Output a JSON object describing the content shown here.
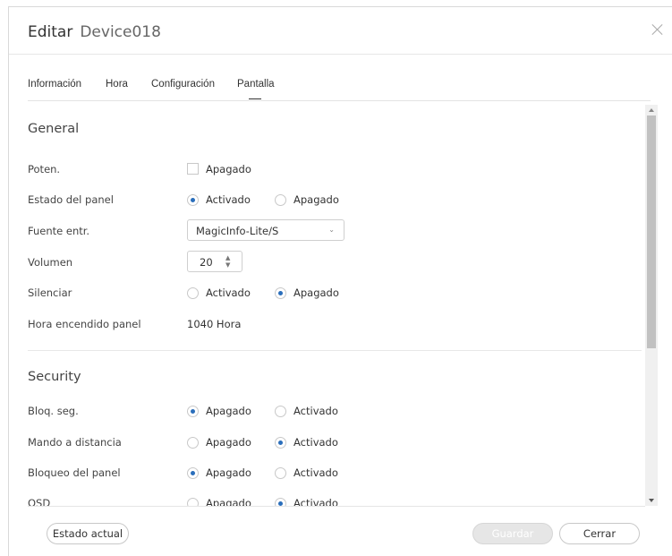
{
  "dialog": {
    "title": "Editar",
    "device_name": "Device018"
  },
  "tabs": [
    {
      "label": "Información",
      "active": false
    },
    {
      "label": "Hora",
      "active": false
    },
    {
      "label": "Configuración",
      "active": false
    },
    {
      "label": "Pantalla",
      "active": true
    }
  ],
  "general": {
    "title": "General",
    "power": {
      "label": "Poten.",
      "checkbox_label": "Apagado",
      "checked": false
    },
    "panel_state": {
      "label": "Estado del panel",
      "options": [
        "Activado",
        "Apagado"
      ],
      "selected": "Activado"
    },
    "input_source": {
      "label": "Fuente entr.",
      "value": "MagicInfo-Lite/S"
    },
    "volume": {
      "label": "Volumen",
      "value": "20"
    },
    "mute": {
      "label": "Silenciar",
      "options": [
        "Activado",
        "Apagado"
      ],
      "selected": "Apagado"
    },
    "panel_on_time": {
      "label": "Hora encendido panel",
      "value": "1040 Hora"
    }
  },
  "security": {
    "title": "Security",
    "safety_lock": {
      "label": "Bloq. seg.",
      "options": [
        "Apagado",
        "Activado"
      ],
      "selected": "Apagado"
    },
    "remote_control": {
      "label": "Mando a distancia",
      "options": [
        "Apagado",
        "Activado"
      ],
      "selected": "Activado"
    },
    "panel_lock": {
      "label": "Bloqueo del panel",
      "options": [
        "Apagado",
        "Activado"
      ],
      "selected": "Apagado"
    },
    "osd": {
      "label": "OSD",
      "options": [
        "Apagado",
        "Activado"
      ],
      "selected": "Activado"
    }
  },
  "footer": {
    "current_state_label": "Estado actual",
    "save_label": "Guardar",
    "close_label": "Cerrar"
  },
  "colors": {
    "accent": "#2a6ebb",
    "disabled_button": "#e6e6e6"
  }
}
